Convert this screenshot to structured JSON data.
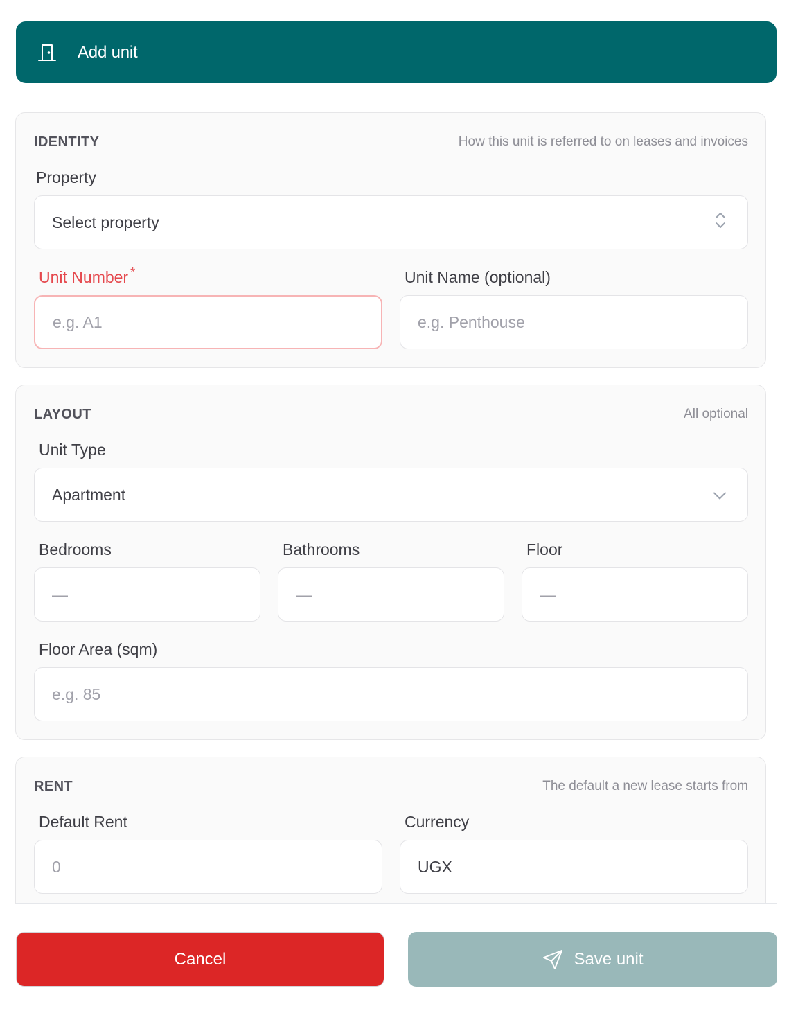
{
  "header": {
    "title": "Add unit",
    "icon": "door-icon"
  },
  "identity": {
    "title": "IDENTITY",
    "hint": "How this unit is referred to on leases and invoices",
    "property_label": "Property",
    "property_value": "Select property",
    "unit_number_label": "Unit Number",
    "unit_number_required": "*",
    "unit_number_placeholder": "e.g. A1",
    "unit_name_label": "Unit Name (optional)",
    "unit_name_placeholder": "e.g. Penthouse"
  },
  "layout": {
    "title": "LAYOUT",
    "hint": "All optional",
    "unit_type_label": "Unit Type",
    "unit_type_value": "Apartment",
    "bedrooms_label": "Bedrooms",
    "bedrooms_placeholder": "—",
    "bathrooms_label": "Bathrooms",
    "bathrooms_placeholder": "—",
    "floor_label": "Floor",
    "floor_placeholder": "—",
    "floor_area_label": "Floor Area (sqm)",
    "floor_area_placeholder": "e.g. 85"
  },
  "rent": {
    "title": "RENT",
    "hint": "The default a new lease starts from",
    "default_rent_label": "Default Rent",
    "default_rent_placeholder": "0",
    "currency_label": "Currency",
    "currency_value": "UGX"
  },
  "actions": {
    "cancel_label": "Cancel",
    "save_label": "Save unit"
  },
  "colors": {
    "header": "#00676b",
    "cancel": "#dc2626",
    "save_disabled": "#99b8b9",
    "error": "#e5484d"
  }
}
